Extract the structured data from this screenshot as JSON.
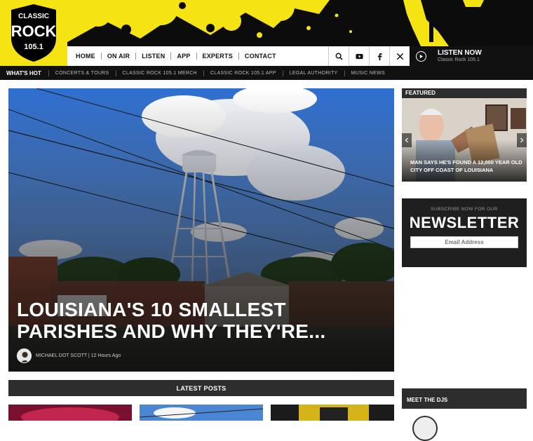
{
  "station": {
    "logo_top": "CLASSIC",
    "logo_main": "ROCK",
    "logo_freq": "105.1",
    "brand_yellow": "#f5e313"
  },
  "nav": {
    "items": [
      "HOME",
      "ON AIR",
      "LISTEN",
      "APP",
      "EXPERTS",
      "CONTACT"
    ]
  },
  "header_icons": [
    "search-icon",
    "youtube-icon",
    "facebook-icon",
    "x-icon"
  ],
  "listen": {
    "title": "LISTEN NOW",
    "subtitle": "Classic Rock 105.1"
  },
  "hotbar": {
    "label": "WHAT'S HOT",
    "items": [
      "CONCERTS & TOURS",
      "CLASSIC ROCK 105.1 MERCH",
      "CLASSIC ROCK 105.1 APP",
      "LEGAL AUTHORITY",
      "MUSIC NEWS"
    ]
  },
  "hero": {
    "title": "LOUISIANA'S 10 SMALLEST PARISHES AND WHY THEY'RE...",
    "byline": "MICHAEL DOT SCOTT | 12 Hours Ago"
  },
  "latest": {
    "label": "LATEST POSTS"
  },
  "featured": {
    "label": "FEATURED",
    "caption": "MAN SAYS HE'S FOUND A 12,000 YEAR OLD CITY OFF COAST OF LOUISIANA"
  },
  "newsletter": {
    "subtitle": "SUBSCRIBE NOW FOR OUR",
    "title": "NEWSLETTER",
    "input_placeholder": "Email Address"
  },
  "djs": {
    "label": "MEET THE DJS"
  }
}
